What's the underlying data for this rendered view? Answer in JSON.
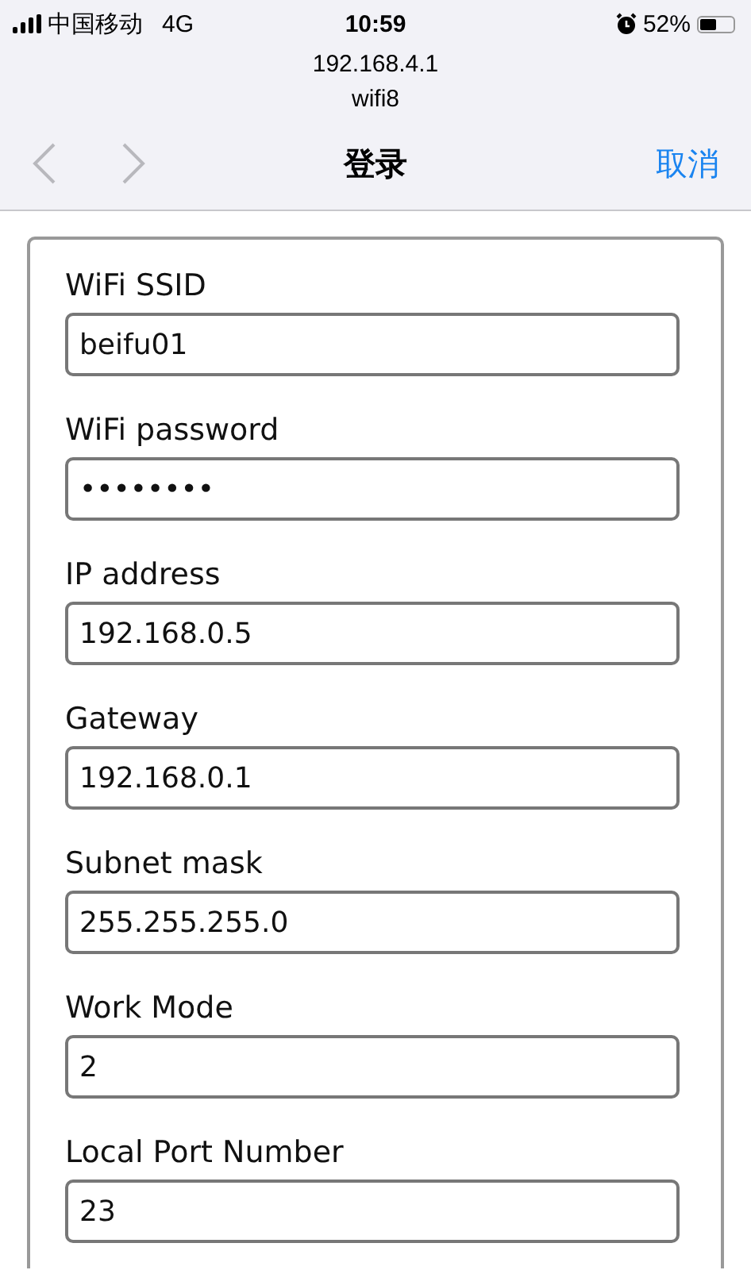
{
  "status_bar": {
    "carrier": "中国移动",
    "network": "4G",
    "time": "10:59",
    "battery": "52%"
  },
  "address": {
    "host": "192.168.4.1",
    "network_name": "wifi8"
  },
  "nav": {
    "back": {
      "disabled": true
    },
    "forward": {
      "disabled": true
    },
    "title": "登录",
    "cancel": "取消"
  },
  "form": {
    "fields": [
      {
        "label": "WiFi SSID",
        "value": "beifu01"
      },
      {
        "label": "WiFi password",
        "value": "••••••••"
      },
      {
        "label": "IP address",
        "value": "192.168.0.5"
      },
      {
        "label": "Gateway",
        "value": "192.168.0.1"
      },
      {
        "label": "Subnet mask",
        "value": "255.255.255.0"
      },
      {
        "label": "Work Mode",
        "value": "2"
      },
      {
        "label": "Local Port Number",
        "value": "23"
      }
    ]
  }
}
